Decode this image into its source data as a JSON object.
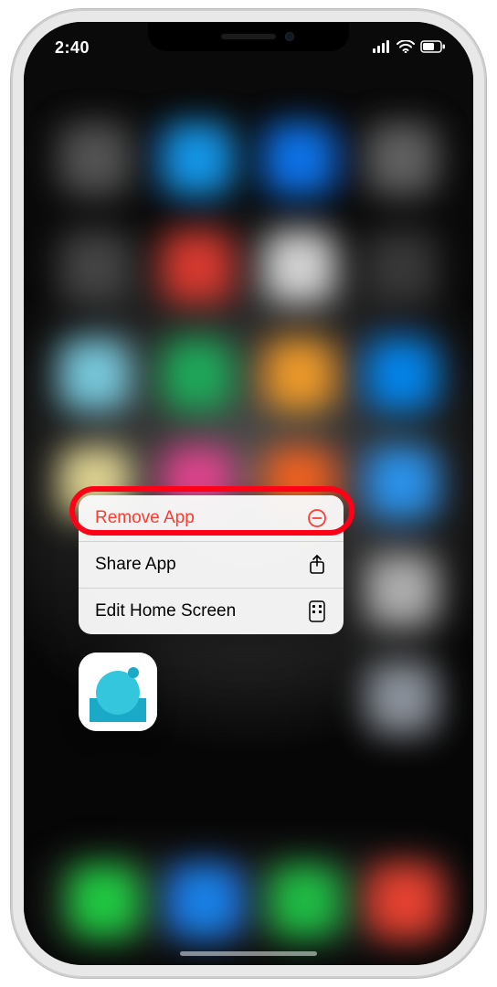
{
  "status": {
    "time": "2:40",
    "signal_icon": "cellular-signal-icon",
    "wifi_icon": "wifi-icon",
    "battery_icon": "battery-icon"
  },
  "context_menu": {
    "items": [
      {
        "label": "Remove App",
        "icon": "remove-circle-icon",
        "destructive": true
      },
      {
        "label": "Share App",
        "icon": "share-icon",
        "destructive": false
      },
      {
        "label": "Edit Home Screen",
        "icon": "apps-grid-icon",
        "destructive": false
      }
    ]
  },
  "annotation": {
    "highlighted_item_index": 0
  },
  "selected_app": {
    "name": "app-icon"
  }
}
